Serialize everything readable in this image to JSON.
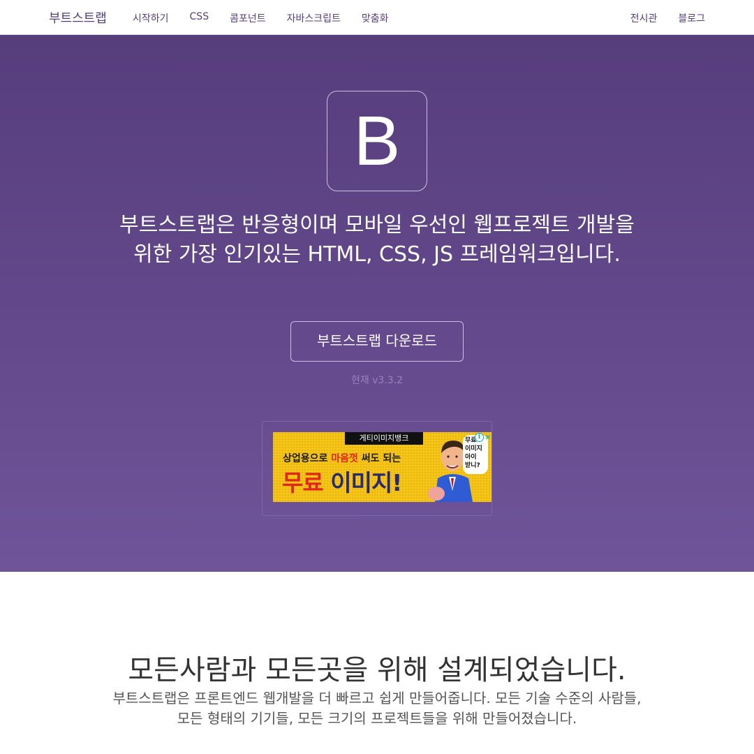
{
  "navbar": {
    "brand": "부트스트랩",
    "links": [
      "시작하기",
      "CSS",
      "콤포넌트",
      "자바스크립트",
      "맞춤화"
    ],
    "right_links": [
      "전시관",
      "블로그"
    ]
  },
  "hero": {
    "logo_letter": "B",
    "lead": "부트스트랩은 반응형이며 모바일 우선인 웹프로젝트 개발을 위한 가장 인기있는 HTML, CSS, JS 프레임워크입니다.",
    "download_label": "부트스트랩 다운로드",
    "version_text": "현재 v3.3.2"
  },
  "ad": {
    "brand": "게티이미지뱅크",
    "line1_prefix": "상업용으로 ",
    "line1_highlight": "마음껏",
    "line1_suffix": " 써도 되는",
    "line2_red": "무료",
    "line2_dark": " 이미지!",
    "bubble_lines": [
      "무료",
      "이미지",
      "아이",
      "받니?"
    ],
    "info_icon": "i",
    "close_icon": "✕"
  },
  "section": {
    "title": "모든사람과 모든곳을 위해 설계되었습니다.",
    "description": "부트스트랩은 프론트엔드 웹개발을 더 빠르고 쉽게 만들어줍니다. 모든 기술 수준의 사람들, 모든 형태의 기기들, 모든 크기의 프로젝트들을 위해 만들어졌습니다."
  },
  "colors": {
    "brand_purple": "#563d7c",
    "hero_gradient_end": "#6f5499",
    "ad_yellow": "#f5c518",
    "ad_red": "#e0261d"
  }
}
